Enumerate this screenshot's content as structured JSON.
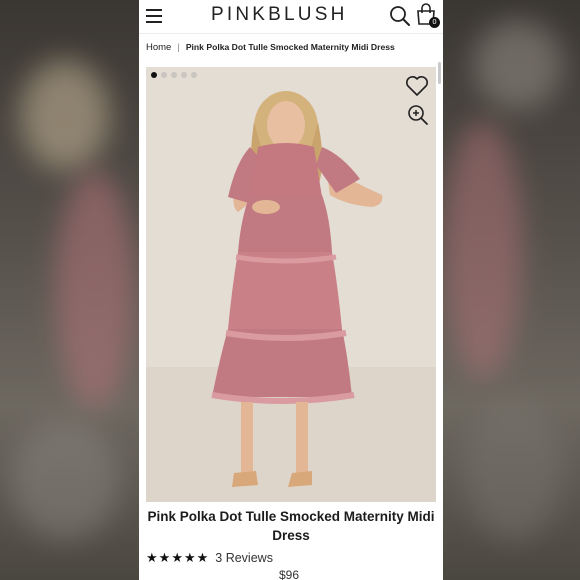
{
  "header": {
    "logo_text": "PINKBLUSH",
    "cart_count": "0",
    "menu_icon": "hamburger-icon",
    "search_icon": "search-icon",
    "cart_icon": "shopping-bag-icon"
  },
  "breadcrumb": {
    "home": "Home",
    "separator": "|",
    "current": "Pink Polka Dot Tulle Smocked Maternity Midi Dress"
  },
  "gallery": {
    "image_count": 5,
    "active_index": 0,
    "wishlist_icon": "heart-icon",
    "zoom_icon": "zoom-in-icon"
  },
  "product": {
    "title_line1": "Pink Polka Dot Tulle Smocked Maternity Midi",
    "title_line2": "Dress",
    "rating": 5,
    "reviews_text": "3 Reviews",
    "price": "$96"
  },
  "colors": {
    "dress": "#c27a82",
    "backdrop": "#e3dcd2",
    "text": "#1c1c1c"
  }
}
